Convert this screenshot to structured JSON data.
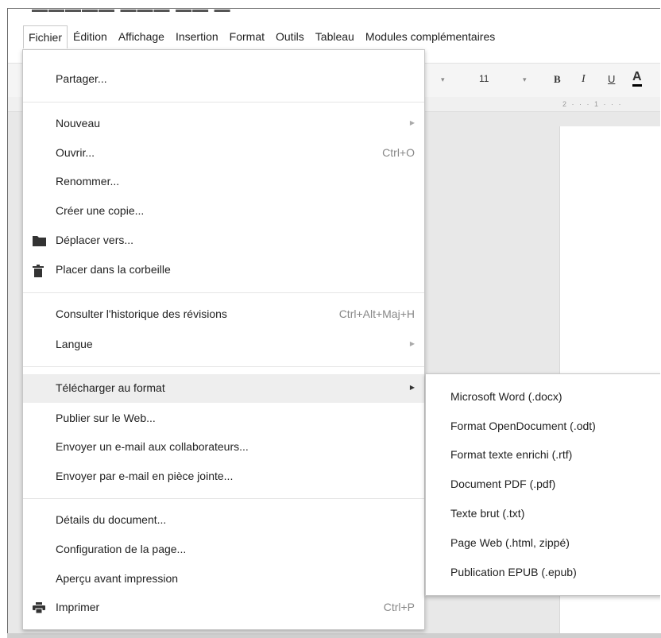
{
  "menubar": {
    "items": [
      "Fichier",
      "Édition",
      "Affichage",
      "Insertion",
      "Format",
      "Outils",
      "Tableau",
      "Modules complémentaires"
    ]
  },
  "toolbar": {
    "font_size": "11",
    "bold": "B",
    "italic": "I",
    "underline": "U",
    "text_color": "A"
  },
  "ruler": {
    "ticks": "2 · · · 1 · · ·"
  },
  "file_menu": {
    "share": "Partager...",
    "new": "Nouveau",
    "open": "Ouvrir...",
    "open_shortcut": "Ctrl+O",
    "rename": "Renommer...",
    "make_copy": "Créer une copie...",
    "move_to": "Déplacer vers...",
    "trash": "Placer dans la corbeille",
    "revision_history": "Consulter l'historique des révisions",
    "revision_history_shortcut": "Ctrl+Alt+Maj+H",
    "language": "Langue",
    "download_as": "Télécharger au format",
    "publish": "Publier sur le Web...",
    "email_collaborators": "Envoyer un e-mail aux collaborateurs...",
    "email_attachment": "Envoyer par e-mail en pièce jointe...",
    "document_details": "Détails du document...",
    "page_setup": "Configuration de la page...",
    "print_preview": "Aperçu avant impression",
    "print": "Imprimer",
    "print_shortcut": "Ctrl+P"
  },
  "download_submenu": {
    "items": [
      "Microsoft Word (.docx)",
      "Format OpenDocument (.odt)",
      "Format texte enrichi (.rtf)",
      "Document PDF (.pdf)",
      "Texte brut (.txt)",
      "Page Web (.html, zippé)",
      "Publication EPUB (.epub)"
    ]
  },
  "icons": {
    "folder": "folder-icon",
    "trash": "trash-icon",
    "printer": "printer-icon",
    "submenu_arrow": "chevron-right-icon"
  }
}
